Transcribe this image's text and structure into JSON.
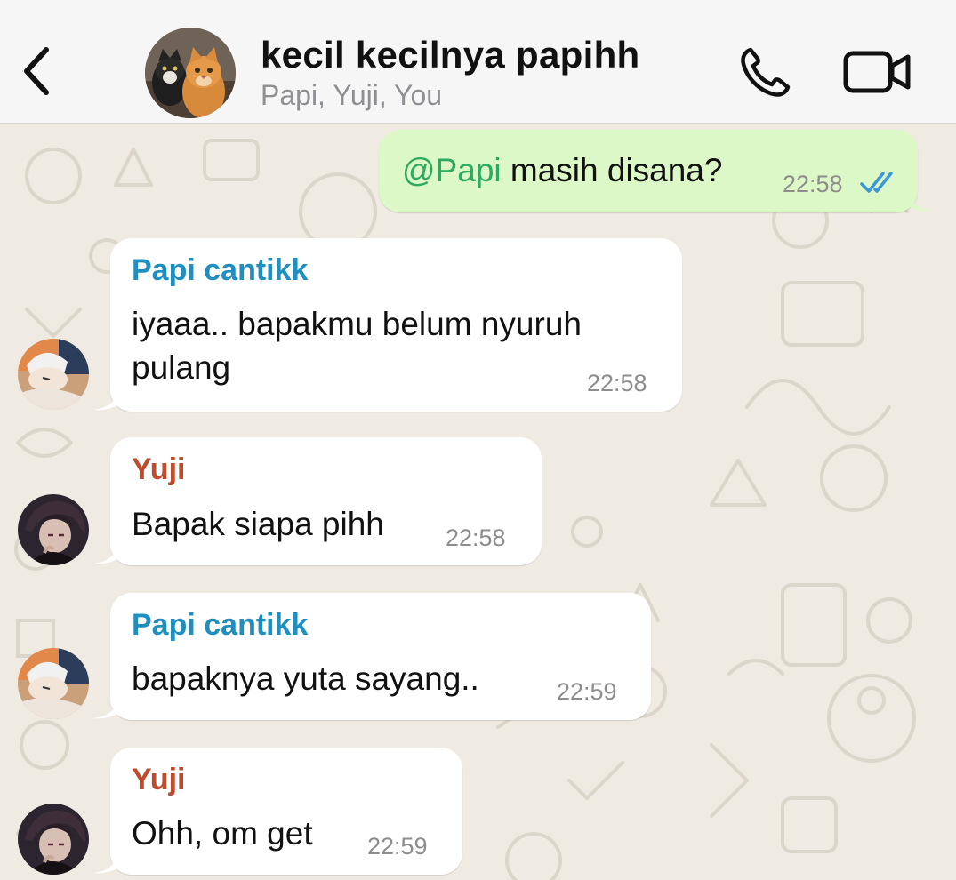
{
  "header": {
    "title": "kecil kecilnya papihh",
    "subtitle": "Papi, Yuji, You"
  },
  "colors": {
    "sender_papi": "#1f8fbf",
    "sender_yuji": "#bf4a2c",
    "mention": "#2da960",
    "read_ticks": "#3b97d8"
  },
  "icons": {
    "back": "chevron-left-icon",
    "call": "phone-icon",
    "video": "video-camera-icon",
    "read": "double-check-icon"
  },
  "messages": [
    {
      "direction": "out",
      "mention": "@Papi",
      "text": " masih disana?",
      "time": "22:58"
    },
    {
      "direction": "in",
      "sender": "Papi cantikk",
      "lines": [
        "iyaaa.. bapakmu belum nyuruh",
        "pulang"
      ],
      "time": "22:58"
    },
    {
      "direction": "in",
      "sender": "Yuji",
      "text": "Bapak siapa pihh",
      "time": "22:58"
    },
    {
      "direction": "in",
      "sender": "Papi cantikk",
      "text": "bapaknya yuta sayang..",
      "time": "22:59"
    },
    {
      "direction": "in",
      "sender": "Yuji",
      "text": "Ohh, om get",
      "time": "22:59"
    }
  ]
}
